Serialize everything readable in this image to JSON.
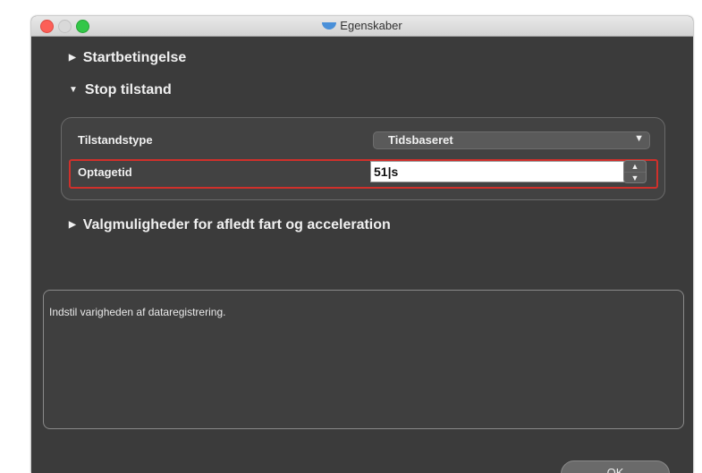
{
  "window": {
    "title": "Egenskaber",
    "app_icon": "boat-icon"
  },
  "sections": [
    {
      "label": "Startbetingelse",
      "expanded": false
    },
    {
      "label": "Stop tilstand",
      "expanded": true
    },
    {
      "label": "Valgmuligheder for afledt fart og acceleration",
      "expanded": false
    }
  ],
  "stop_condition": {
    "condition_type_label": "Tilstandstype",
    "condition_type_value": "Tidsbaseret",
    "recording_time_label": "Optagetid",
    "recording_time_value": "51|s"
  },
  "description": {
    "text": "Indstil varigheden af dataregistrering."
  },
  "buttons": {
    "ok_label": "OK"
  },
  "colors": {
    "window_bg": "#3b3b3b",
    "highlight": "#d0302b",
    "close_light": "#fc5f57",
    "zoom_light": "#33c748"
  }
}
